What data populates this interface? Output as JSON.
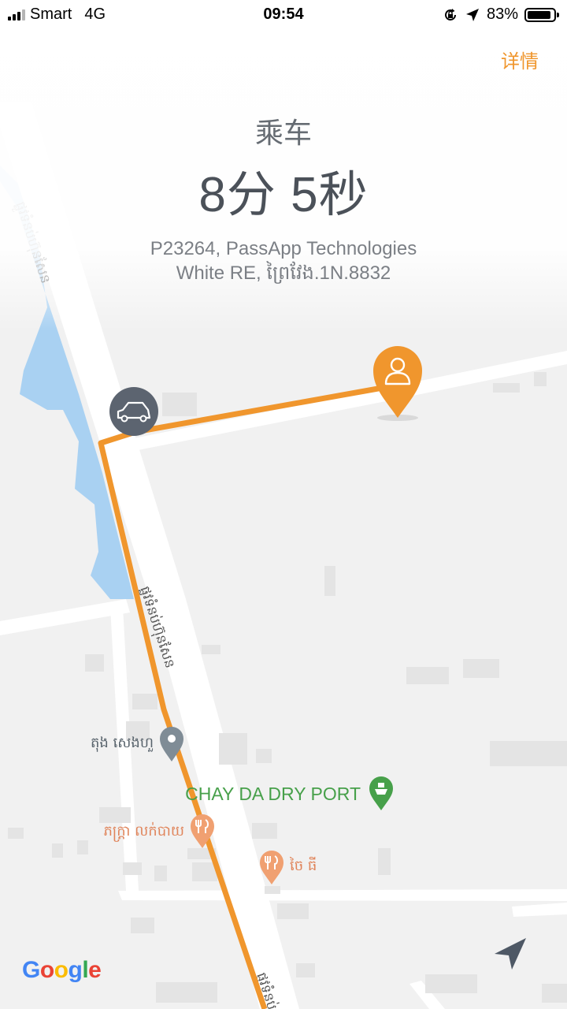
{
  "status_bar": {
    "carrier": "Smart",
    "network": "4G",
    "time": "09:54",
    "battery": "83%",
    "battery_level": 0.83
  },
  "header": {
    "details_link": "详情",
    "label": "乘车",
    "eta": "8分 5秒",
    "vehicle_line1": "P23264, PassApp Technologies",
    "vehicle_line2": "White RE, ព្រៃវែង.1N.8832"
  },
  "map": {
    "pois": [
      {
        "name": "តុង សេងហួ",
        "type": "place-pin"
      },
      {
        "name": "CHAY DA DRY PORT",
        "type": "port-pin"
      },
      {
        "name": "ភក្រ្តា លក់បាយ",
        "type": "restaurant-pin"
      },
      {
        "name": "ចៃ ធី",
        "type": "restaurant-pin"
      }
    ],
    "road_label": "ផ្លូវទំនប់ហ៊ុនសែន",
    "route_color": "#f0962d",
    "car_marker_icon": "car-icon",
    "pickup_marker_icon": "person-pin-icon"
  },
  "footer": {
    "logo": {
      "g1": "G",
      "o1": "o",
      "o2": "o",
      "g2": "g",
      "l": "l",
      "e": "e"
    },
    "locate_icon": "navigation-arrow-icon"
  }
}
